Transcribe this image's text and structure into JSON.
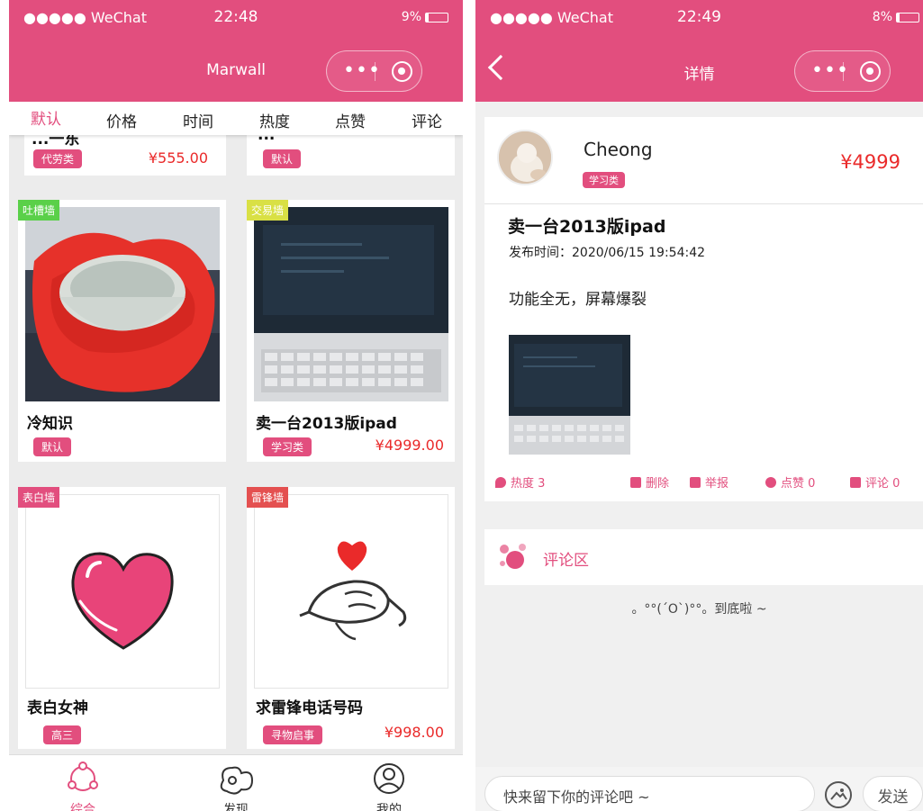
{
  "left": {
    "status": {
      "signal": "●●●●● WeChat",
      "time": "22:48",
      "battery": "9%"
    },
    "nav": {
      "title": "Marwall"
    },
    "tabs": [
      "默认",
      "价格",
      "时间",
      "热度",
      "点赞",
      "评论"
    ],
    "cards": [
      {
        "title": "...一东",
        "tag": "代劳类",
        "price": "¥555.00"
      },
      {
        "title": "...",
        "tag": "默认",
        "price": ""
      },
      {
        "wall": "吐槽墙",
        "wall_color": "#5ad049",
        "title": "冷知识",
        "tag": "默认",
        "price": ""
      },
      {
        "wall": "交易墙",
        "wall_color": "#d9e045",
        "title": "卖一台2013版ipad",
        "tag": "学习类",
        "price": "¥4999.00"
      },
      {
        "wall": "表白墙",
        "wall_color": "#e24e7e",
        "title": "表白女神",
        "tag": "高三",
        "price": ""
      },
      {
        "wall": "雷锋墙",
        "wall_color": "#e45050",
        "title": "求雷锋电话号码",
        "tag": "寻物启事",
        "price": "¥998.00"
      }
    ],
    "bottomnav": [
      {
        "label": "综合",
        "icon": "home-rings-icon"
      },
      {
        "label": "发现",
        "icon": "discover-icon"
      },
      {
        "label": "我的",
        "icon": "user-icon"
      }
    ]
  },
  "right": {
    "status": {
      "signal": "●●●●● WeChat",
      "time": "22:49",
      "battery": "8%"
    },
    "nav": {
      "title": "详情"
    },
    "post": {
      "author": "Cheong",
      "author_tag": "学习类",
      "price": "¥4999",
      "title": "卖一台2013版ipad",
      "time": "发布时间：2020/06/15 19:54:42",
      "body": "功能全无，屏幕爆裂",
      "actions": {
        "heat": "热度 3",
        "delete": "删除",
        "report": "举报",
        "like": "点赞 0",
        "comment": "评论 0"
      }
    },
    "comments": {
      "label": "评论区",
      "end": "。°°(´O`)°°。到底啦 ~"
    },
    "input": {
      "placeholder": "快来留下你的评论吧 ~",
      "send": "发送"
    }
  },
  "colors": {
    "brand": "#e24e7e",
    "price": "#ea2a2a"
  }
}
